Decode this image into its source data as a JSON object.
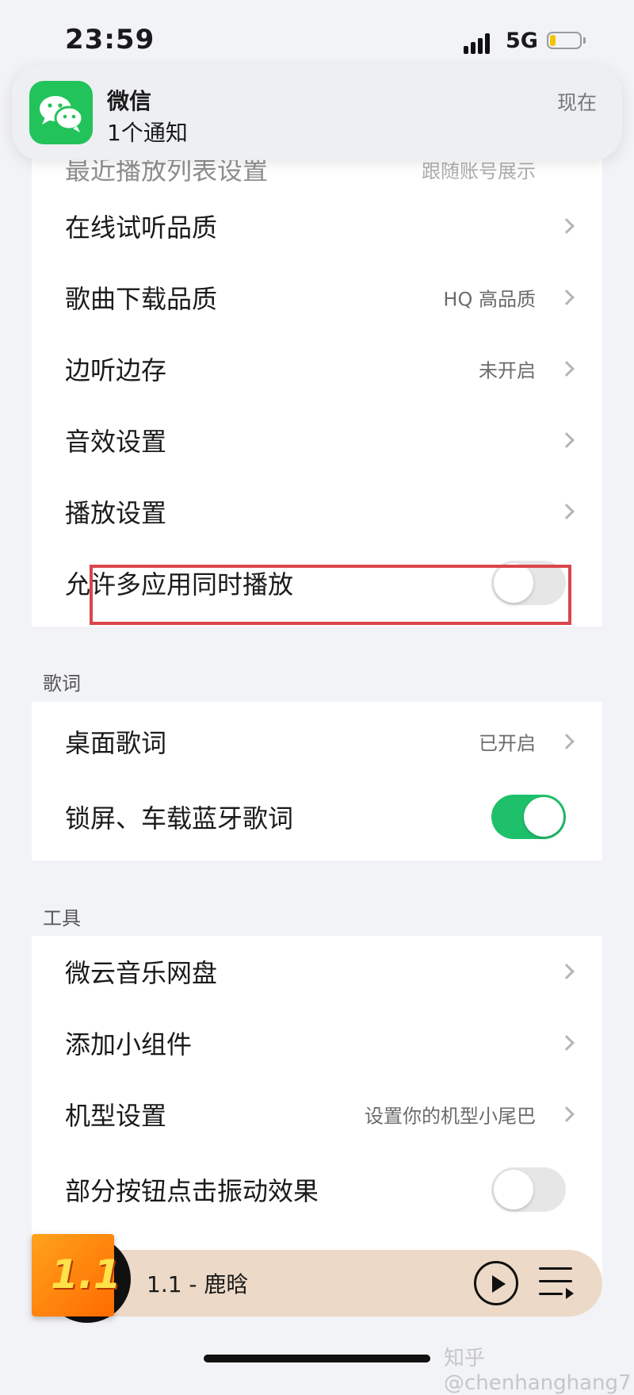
{
  "status_bar": {
    "time": "23:59",
    "network": "5G"
  },
  "notification": {
    "app": "微信",
    "message": "1个通知",
    "time": "现在"
  },
  "playback_section": {
    "partial_top_label": "最近播放列表设置",
    "partial_top_value": "跟随账号展示",
    "items": [
      {
        "label": "在线试听品质",
        "value": ""
      },
      {
        "label": "歌曲下载品质",
        "value": "HQ 高品质"
      },
      {
        "label": "边听边存",
        "value": "未开启"
      },
      {
        "label": "音效设置",
        "value": ""
      },
      {
        "label": "播放设置",
        "value": ""
      }
    ],
    "multi_app_label": "允许多应用同时播放",
    "multi_app_enabled": false
  },
  "lyrics_section": {
    "title": "歌词",
    "desktop_label": "桌面歌词",
    "desktop_value": "已开启",
    "lockscreen_label": "锁屏、车载蓝牙歌词",
    "lockscreen_enabled": true
  },
  "tools_section": {
    "title": "工具",
    "items": [
      {
        "label": "微云音乐网盘",
        "value": ""
      },
      {
        "label": "添加小组件",
        "value": ""
      },
      {
        "label": "机型设置",
        "value": "设置你的机型小尾巴"
      }
    ],
    "vibration_label": "部分按钮点击振动效果",
    "vibration_enabled": false
  },
  "mini_player": {
    "cover_text": "1.1",
    "song": "1.1 - 鹿晗"
  },
  "watermark": "知乎 @chenhanghang7",
  "colors": {
    "accent_green": "#1fc06b",
    "highlight_red": "#d9464b",
    "wechat_green": "#22c35a"
  }
}
